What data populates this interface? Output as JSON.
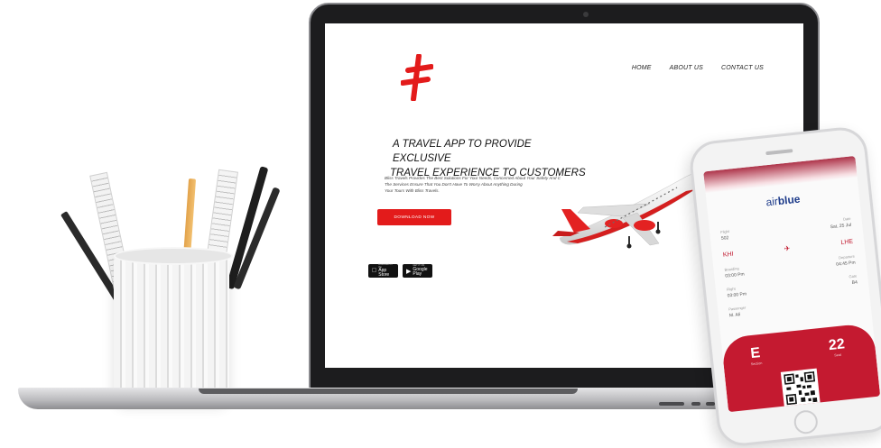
{
  "website": {
    "nav": {
      "home": "HOME",
      "about": "ABOUT US",
      "contact": "CONTACT US"
    },
    "headline_line1": "A TRAVEL APP TO PROVIDE EXCLUSIVE",
    "headline_line2": "TRAVEL EXPERIENCE TO CUSTOMERS",
    "body_line1": "Bliss Travels Provides The Best Solutions For Your Needs, Concerned About Your Safety And C",
    "body_line2": "The Services Ensure That You Don't Have To Worry About Anything During",
    "body_line3": "Your Tours With Bliss Travels.",
    "download_label": "DOWNLOAD NOW",
    "app_store": {
      "small": "Download on the",
      "big": "App Store"
    },
    "google_play": {
      "small": "GET IT ON",
      "big": "Google Play"
    },
    "accent_color": "#e31b1b"
  },
  "phone": {
    "airline_light": "air",
    "airline_bold": "blue",
    "flight_label": "Flight",
    "flight_value": "502",
    "date_label": "Date",
    "date_value": "Sat, 25 Jul",
    "from_code": "KHI",
    "to_code": "LHE",
    "boarding_label": "Boarding",
    "boarding_value": "03:00 Pm",
    "departure_label": "Departure",
    "departure_value": "04:45 Pm",
    "flight_time_label": "Flight",
    "flight_time_value": "03:00 Pm",
    "gate_label": "Gate",
    "gate_value": "B4",
    "passenger_label": "Passenger",
    "passenger_value": "M. Ali",
    "section_value": "E",
    "section_label": "Section",
    "seat_value": "22",
    "seat_label": "Seat",
    "ticket_color": "#c41a30"
  }
}
